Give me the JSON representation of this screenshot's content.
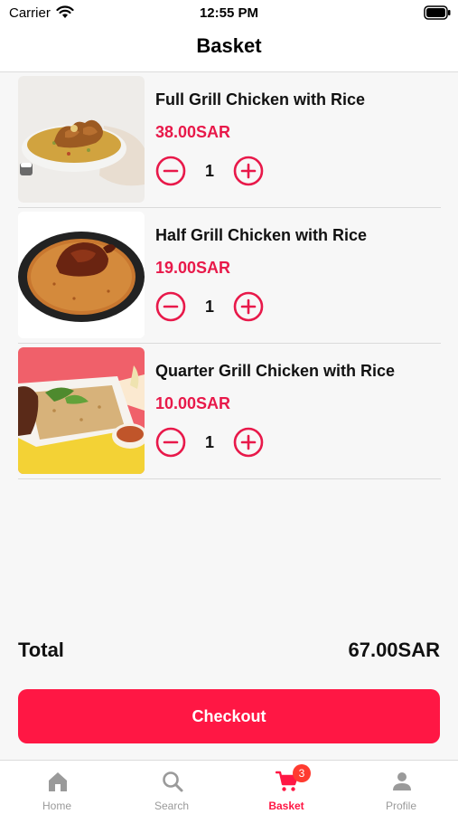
{
  "status_bar": {
    "carrier": "Carrier",
    "time": "12:55 PM"
  },
  "header": {
    "title": "Basket"
  },
  "items": [
    {
      "name": "Full Grill Chicken with Rice",
      "price": "38.00SAR",
      "quantity": "1"
    },
    {
      "name": "Half Grill Chicken with Rice",
      "price": "19.00SAR",
      "quantity": "1"
    },
    {
      "name": "Quarter Grill Chicken with Rice",
      "price": "10.00SAR",
      "quantity": "1"
    }
  ],
  "total": {
    "label": "Total",
    "value": "67.00SAR"
  },
  "checkout": {
    "label": "Checkout"
  },
  "tabs": [
    {
      "label": "Home",
      "icon": "home-icon"
    },
    {
      "label": "Search",
      "icon": "search-icon"
    },
    {
      "label": "Basket",
      "icon": "cart-icon",
      "badge": "3"
    },
    {
      "label": "Profile",
      "icon": "person-icon"
    }
  ],
  "colors": {
    "accent": "#ff1744",
    "price": "#e8194a",
    "inactive_tab": "#9a9a9a",
    "badge": "#ff3b30"
  }
}
